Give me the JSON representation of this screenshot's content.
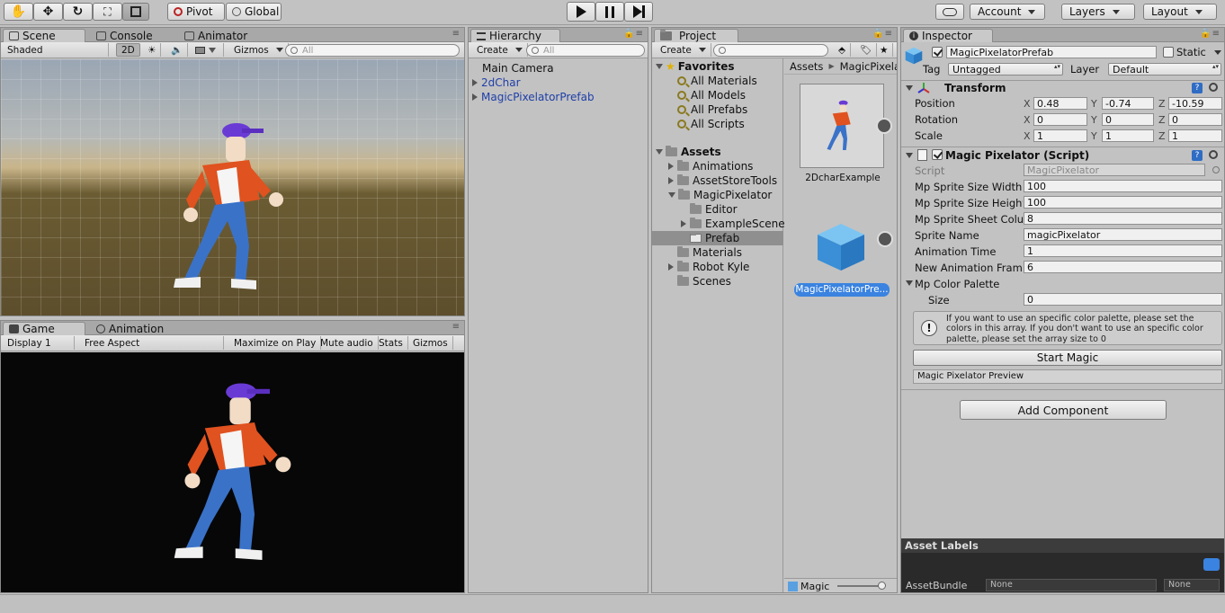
{
  "toolbar": {
    "pivot": "Pivot",
    "global": "Global",
    "account": "Account",
    "layers": "Layers",
    "layout": "Layout"
  },
  "scene": {
    "tabs": [
      "Scene",
      "Console",
      "Animator"
    ],
    "shaded": "Shaded",
    "mode2d": "2D",
    "gizmos": "Gizmos",
    "search_placeholder": "All"
  },
  "game": {
    "tabs": [
      "Game",
      "Animation"
    ],
    "display": "Display 1",
    "aspect": "Free Aspect",
    "maximize": "Maximize on Play",
    "mute": "Mute audio",
    "stats": "Stats",
    "gizmos": "Gizmos"
  },
  "hierarchy": {
    "tab": "Hierarchy",
    "create": "Create",
    "search_placeholder": "All",
    "items": [
      "Main Camera",
      "2dChar",
      "MagicPixelatorPrefab"
    ]
  },
  "project": {
    "tab": "Project",
    "create": "Create",
    "favorites": "Favorites",
    "favorite_items": [
      "All Materials",
      "All Models",
      "All Prefabs",
      "All Scripts"
    ],
    "assets": "Assets",
    "asset_tree": [
      "Animations",
      "AssetStoreTools",
      "MagicPixelator",
      "Editor",
      "ExampleScene",
      "Prefab",
      "Materials",
      "Robot Kyle",
      "Scenes"
    ],
    "breadcrumb": [
      "Assets",
      "MagicPixela"
    ],
    "grid_items": [
      "2DcharExample",
      "MagicPixelatorPre..."
    ],
    "footer": "Magic"
  },
  "inspector": {
    "tab": "Inspector",
    "object_name": "MagicPixelatorPrefab",
    "static": "Static",
    "tag_label": "Tag",
    "tag": "Untagged",
    "layer_label": "Layer",
    "layer": "Default",
    "transform": {
      "title": "Transform",
      "labels": [
        "Position",
        "Rotation",
        "Scale"
      ],
      "position": [
        "0.48",
        "-0.74",
        "-10.59"
      ],
      "rotation": [
        "0",
        "0",
        "0"
      ],
      "scale": [
        "1",
        "1",
        "1"
      ]
    },
    "script": {
      "title": "Magic Pixelator (Script)",
      "script_label": "Script",
      "script_value": "MagicPixelator",
      "fields": [
        {
          "label": "Mp Sprite Size Width",
          "value": "100"
        },
        {
          "label": "Mp Sprite Size Height",
          "value": "100"
        },
        {
          "label": "Mp Sprite Sheet Colu",
          "value": "8"
        },
        {
          "label": "Sprite Name",
          "value": "magicPixelator"
        },
        {
          "label": "Animation Time",
          "value": "1"
        },
        {
          "label": "New Animation Frame",
          "value": "6"
        }
      ],
      "palette_label": "Mp Color Palette",
      "size_label": "Size",
      "size_value": "0",
      "help": "If you want to use an specific color palette, please set the colors in this array. If you don't want to use an specific color palette, please set the array size to 0",
      "start_button": "Start Magic",
      "preview": "Magic Pixelator Preview"
    },
    "add_component": "Add Component",
    "asset_labels": "Asset Labels",
    "asset_bundle_label": "AssetBundle",
    "bundle_value": "None",
    "variant_value": "None"
  }
}
